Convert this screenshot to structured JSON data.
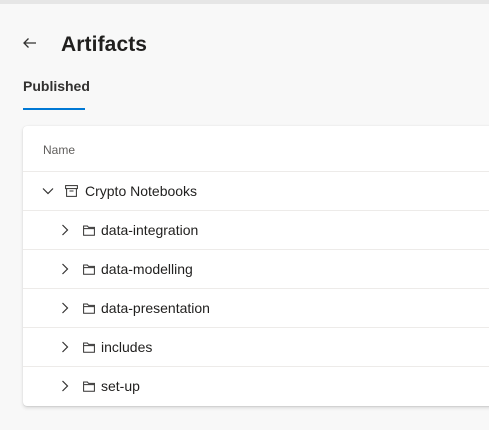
{
  "page": {
    "title": "Artifacts"
  },
  "tabs": [
    {
      "label": "Published",
      "selected": true
    }
  ],
  "table": {
    "column_header": "Name",
    "root": {
      "label": "Crypto Notebooks",
      "icon": "repository-icon",
      "expanded": true
    },
    "children": [
      {
        "label": "data-integration",
        "icon": "folder-icon",
        "expanded": false
      },
      {
        "label": "data-modelling",
        "icon": "folder-icon",
        "expanded": false
      },
      {
        "label": "data-presentation",
        "icon": "folder-icon",
        "expanded": false
      },
      {
        "label": "includes",
        "icon": "folder-icon",
        "expanded": false
      },
      {
        "label": "set-up",
        "icon": "folder-icon",
        "expanded": false
      }
    ]
  },
  "colors": {
    "accent": "#0078d4",
    "background": "#f8f8f8",
    "card": "#ffffff",
    "divider": "#edebe9"
  }
}
